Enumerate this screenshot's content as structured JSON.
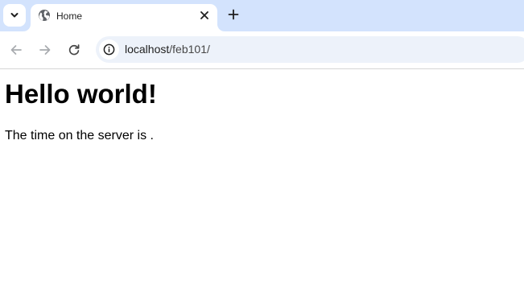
{
  "browser": {
    "tab": {
      "title": "Home",
      "favicon": "globe-icon"
    },
    "new_tab_icon": "plus-icon",
    "tab_search_icon": "chevron-down-icon",
    "toolbar": {
      "back_icon": "arrow-left-icon",
      "forward_icon": "arrow-right-icon",
      "reload_icon": "reload-icon",
      "site_info_icon": "info-icon"
    },
    "address": {
      "host": "localhost",
      "path": "/feb101/"
    },
    "colors": {
      "tabstrip": "#d3e3fd",
      "omnibox": "#edf2fa"
    }
  },
  "page": {
    "heading": "Hello world!",
    "paragraph": "The time on the server is ."
  }
}
